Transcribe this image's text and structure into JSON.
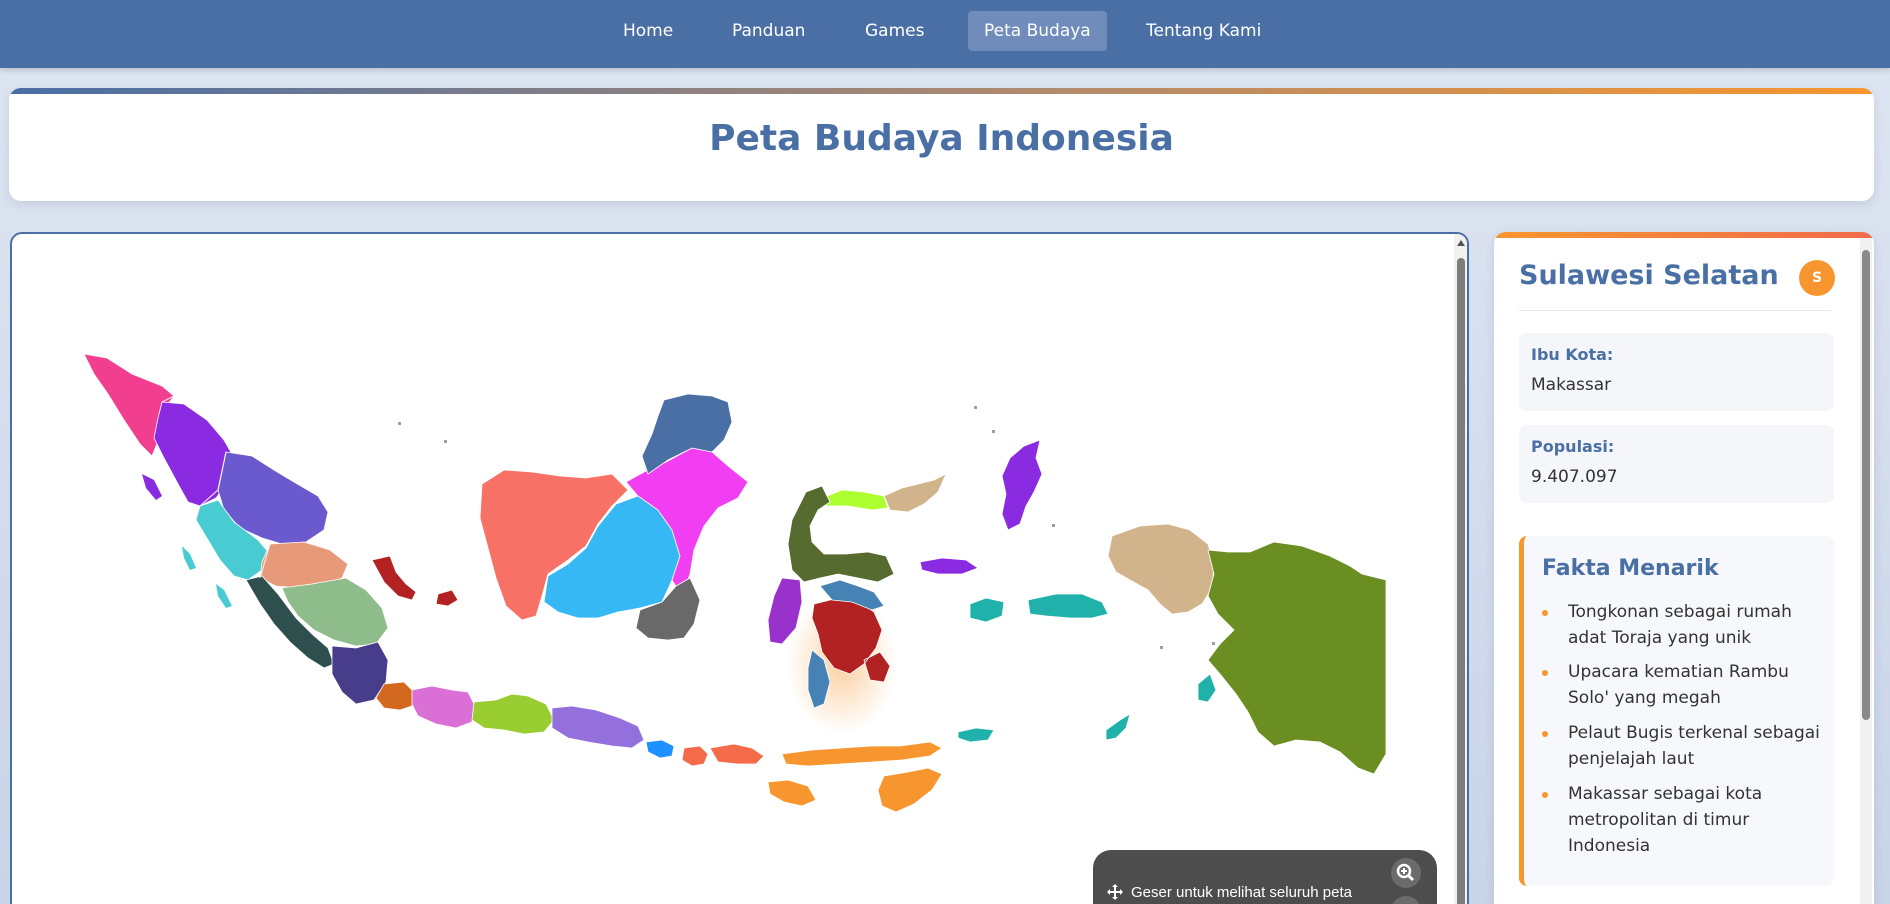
{
  "nav": {
    "items": [
      {
        "label": "Home",
        "active": false
      },
      {
        "label": "Panduan",
        "active": false
      },
      {
        "label": "Games",
        "active": false
      },
      {
        "label": "Peta Budaya",
        "active": true
      },
      {
        "label": "Tentang Kami",
        "active": false
      }
    ]
  },
  "header": {
    "title": "Peta Budaya Indonesia"
  },
  "map": {
    "hint": "Geser untuk melihat seluruh peta",
    "icons": {
      "move": "move-icon",
      "zoom": "zoom-in-icon"
    },
    "selected_region": "Sulawesi Selatan",
    "colors": {
      "aceh": "#f23e8f",
      "sumut": "#8a2be2",
      "riau": "#6a5acd",
      "sumbar": "#48cbd1",
      "jambi": "#e79a79",
      "sumsel": "#8fbc8b",
      "bengkulu": "#2f4f4f",
      "lampung": "#483d8b",
      "babel": "#b22222",
      "kalbar": "#f77166",
      "kalteng": "#36b8f5",
      "kaltim": "#f23ef3",
      "kaltara": "#4a6fa5",
      "kalsel": "#696969",
      "sulbar": "#9932cc",
      "sulteng": "#556b2f",
      "gorontalo": "#adff2f",
      "sulut": "#d2b48c",
      "sulsel": "#b22222",
      "sultra": "#4682b4",
      "malut": "#8a2be2",
      "maluku": "#20b2aa",
      "papua_barat": "#d2b48c",
      "papua": "#6b8e23",
      "banten": "#d2691e",
      "jabar": "#da70d6",
      "jateng": "#9acd32",
      "jatim": "#9370db",
      "bali": "#1e90ff",
      "ntb": "#f46b4a",
      "ntt": "#f7962f"
    }
  },
  "info": {
    "province": "Sulawesi Selatan",
    "badge": "S",
    "capital_label": "Ibu Kota:",
    "capital": "Makassar",
    "population_label": "Populasi:",
    "population": "9.407.097",
    "facts_title": "Fakta Menarik",
    "facts": [
      "Tongkonan sebagai rumah adat Toraja yang unik",
      "Upacara kematian Rambu Solo' yang megah",
      "Pelaut Bugis terkenal sebagai penjelajah laut",
      "Makassar sebagai kota metropolitan di timur Indonesia"
    ]
  }
}
